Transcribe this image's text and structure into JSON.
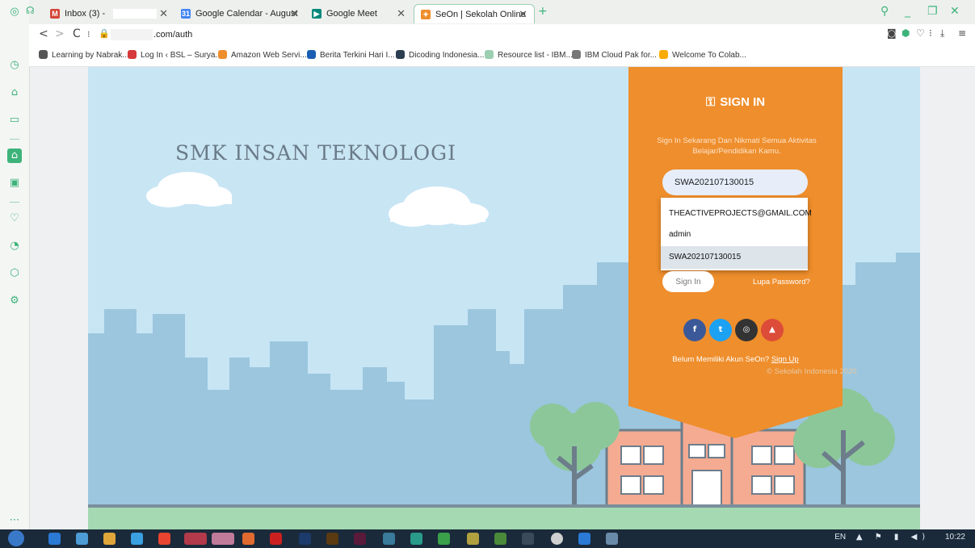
{
  "browser": {
    "tabs": [
      {
        "title": "Inbox (3) -",
        "favicon": "gmail-icon",
        "color": "#d44638"
      },
      {
        "title": "Google Calendar - August",
        "favicon": "calendar-icon",
        "color": "#4285f4"
      },
      {
        "title": "Google Meet",
        "favicon": "meet-icon",
        "color": "#00897b"
      },
      {
        "title": "SeOn | Sekolah Online",
        "favicon": "seon-icon",
        "color": "#ef8e2c"
      }
    ],
    "new_tab": "+",
    "address": ".com/auth",
    "bookmarks": [
      {
        "label": "Learning by Nabrak...",
        "color": "#555555"
      },
      {
        "label": "Log In ‹ BSL – Surya...",
        "color": "#d63a3a"
      },
      {
        "label": "Amazon Web Servi...",
        "color": "#ef8e2c"
      },
      {
        "label": "Berita Terkini Hari I...",
        "color": "#1a5fb4"
      },
      {
        "label": "Dicoding Indonesia...",
        "color": "#2d3e50"
      },
      {
        "label": "Resource list - IBM...",
        "color": "#9ccfb1"
      },
      {
        "label": "IBM Cloud Pak for...",
        "color": "#777777"
      },
      {
        "label": "Welcome To Colab...",
        "color": "#f9ab00"
      }
    ]
  },
  "page": {
    "site_title": "SMK INSAN TEKNOLOGI",
    "signin": {
      "title": "SIGN IN",
      "description": "Sign In Sekarang Dan Nikmati Semua Aktivitas Belajar/Pendidikan Kamu.",
      "username_value": "SWA202107130015",
      "autocomplete": [
        "THEACTIVEPROJECTS@GMAIL.COM",
        "admin",
        "SWA202107130015"
      ],
      "button": "Sign In",
      "forgot": "Lupa Password?",
      "social": [
        {
          "label": "f",
          "color": "#3b5998"
        },
        {
          "label": "t",
          "color": "#1da1f2"
        },
        {
          "label": "◎",
          "color": "#333333"
        },
        {
          "label": "▲",
          "color": "#dd4b39"
        }
      ],
      "signup_prompt": "Belum Memiliki Akun SeOn?",
      "signup_link": "Sign Up",
      "copyright": "© Sekolah Indonesia 2020"
    }
  },
  "taskbar": {
    "language": "EN",
    "time": "10:22"
  }
}
